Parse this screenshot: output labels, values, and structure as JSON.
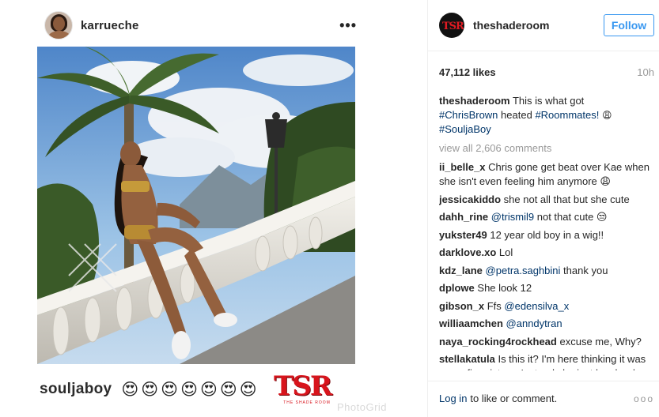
{
  "embedded_post": {
    "username": "karrueche",
    "more_icon": "more-horizontal-icon"
  },
  "caption_overlay": {
    "username": "souljaboy",
    "emojis": "😍😍😍😍😍😍😍",
    "logo_text": "TSR",
    "logo_subtext": "THE SHADE ROOM",
    "watermark": "PhotoGrid"
  },
  "sidebar": {
    "username": "theshaderoom",
    "avatar_text": "TSR",
    "follow_label": "Follow",
    "likes": "47,112 likes",
    "time": "10h",
    "caption": {
      "username": "theshaderoom",
      "text_1": "This is what got",
      "tag_1": "#ChrisBrown",
      "text_2": "heated",
      "tag_2": "#Roommates!",
      "emoji": "😩",
      "tag_3": "#SouljaBoy"
    },
    "view_all": "view all 2,606 comments",
    "comments": [
      {
        "user": "ii_belle_x",
        "text": "Chris gone get beat over Kae when she isn't even feeling him anymore 😩"
      },
      {
        "user": "jessicakiddo",
        "text": "she not all that but she cute"
      },
      {
        "user": "dahh_rine",
        "mention": "@trismil9",
        "text": "not that cute 😒"
      },
      {
        "user": "yukster49",
        "text": "12 year old boy in a wig!!"
      },
      {
        "user": "darklove.xo",
        "text": "Lol"
      },
      {
        "user": "kdz_lane",
        "mention": "@petra.saghbini",
        "text": "thank you"
      },
      {
        "user": "dplowe",
        "text": "She look 12"
      },
      {
        "user": "gibson_x",
        "text": "Ffs",
        "mention": "@edensilva_x"
      },
      {
        "user": "williaamchen",
        "mention": "@anndytran"
      },
      {
        "user": "naya_rocking4rockhead",
        "text": "excuse me, Why?"
      },
      {
        "user": "stellakatula",
        "text": "Is this it? I'm here thinking it was some fire picture. Instead she just has her legs open 😂😂"
      }
    ],
    "login_link": "Log in",
    "login_text": "to like or comment.",
    "more_icon": "more-options-icon",
    "more_glyph": "ooo"
  }
}
